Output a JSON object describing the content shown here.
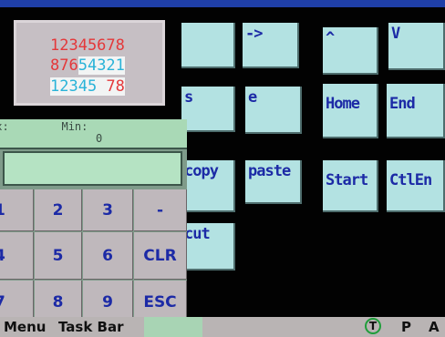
{
  "display": {
    "line1": "12345678",
    "line2_a": "876",
    "line2_b": "54321",
    "line3_a": "12345 ",
    "line3_b": "78"
  },
  "tiles": {
    "arrow_right": "->",
    "caret": "^",
    "chevron_down": "V",
    "s_partial": "s",
    "e_partial": "e",
    "home": "Home",
    "end": "End",
    "copy_partial": "copy",
    "paste": "paste",
    "start": "Start",
    "ctlend_partial": "CtlEn",
    "cut_partial": "cut"
  },
  "numpad": {
    "header": "ax:        Min:",
    "min_value": "0",
    "input_value": "",
    "keys": [
      "1",
      "2",
      "3",
      "-",
      "4",
      "5",
      "6",
      "CLR",
      "7",
      "8",
      "9",
      "ESC"
    ]
  },
  "taskbar": {
    "menu": "Menu",
    "taskbar": "Task Bar",
    "indicator_t": "T",
    "indicator_p": "P",
    "indicator_a": "A"
  },
  "colors": {
    "tile_bg": "#b3e2e2",
    "tile_text": "#1c2aa6",
    "digit_red": "#e4383a",
    "digit_cyan": "#2ab3d8",
    "pad_header": "#a9d9b6",
    "key_bg": "#bfb8bc",
    "taskbar_bg": "#b9b4b4",
    "top_strip": "#1f3fa8"
  }
}
